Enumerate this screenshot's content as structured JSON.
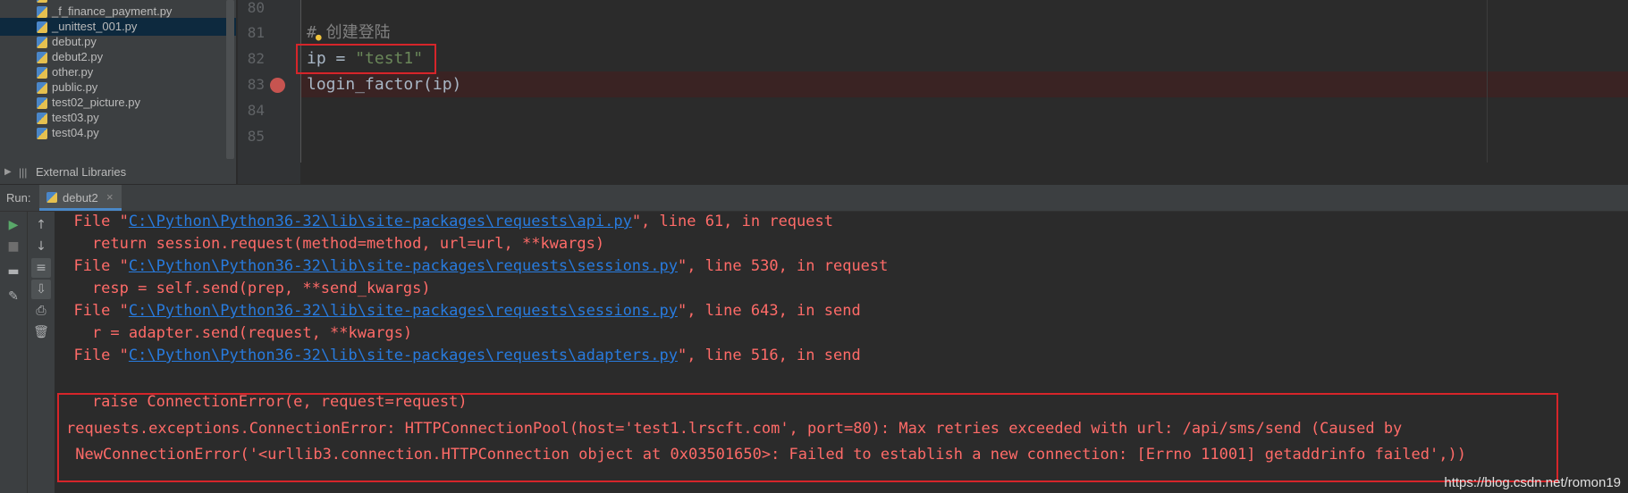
{
  "project_tree": {
    "files": [
      {
        "name": "_f_finance_payment.py",
        "selected": false
      },
      {
        "name": "_unittest_001.py",
        "selected": true
      },
      {
        "name": "debut.py",
        "selected": false
      },
      {
        "name": "debut2.py",
        "selected": false
      },
      {
        "name": "other.py",
        "selected": false
      },
      {
        "name": "public.py",
        "selected": false
      },
      {
        "name": "test02_picture.py",
        "selected": false
      },
      {
        "name": "test03.py",
        "selected": false
      },
      {
        "name": "test04.py",
        "selected": false
      }
    ],
    "external_libraries": "External Libraries"
  },
  "editor": {
    "line_numbers": [
      "80",
      "81",
      "82",
      "83",
      "84",
      "85"
    ],
    "lines": {
      "l81_comment": "# 创建登陆",
      "l82_var": "ip = ",
      "l82_str": "\"test1\"",
      "l83": "login_factor(ip)"
    },
    "breakpoint_line": "83",
    "highlight_color": "#d6252a"
  },
  "run_panel": {
    "label": "Run:",
    "tab": "debut2",
    "close_glyph": "×",
    "console": [
      {
        "pre": "  File \"",
        "link": "C:\\Python\\Python36-32\\lib\\site-packages\\requests\\api.py",
        "post": "\", line 61, in request"
      },
      {
        "text": "    return session.request(method=method, url=url, **kwargs)"
      },
      {
        "pre": "  File \"",
        "link": "C:\\Python\\Python36-32\\lib\\site-packages\\requests\\sessions.py",
        "post": "\", line 530, in request"
      },
      {
        "text": "    resp = self.send(prep, **send_kwargs)"
      },
      {
        "pre": "  File \"",
        "link": "C:\\Python\\Python36-32\\lib\\site-packages\\requests\\sessions.py",
        "post": "\", line 643, in send"
      },
      {
        "text": "    r = adapter.send(request, **kwargs)"
      },
      {
        "pre": "  File \"",
        "link": "C:\\Python\\Python36-32\\lib\\site-packages\\requests\\adapters.py",
        "post": "\", line 516, in send"
      },
      {
        "text": "    raise ConnectionError(e, request=request)"
      },
      {
        "text": "requests.exceptions.ConnectionError: HTTPConnectionPool(host='test1.lrscft.com', port=80): Max retries exceeded with url: /api/sms/send (Caused by"
      },
      {
        "text": " NewConnectionError('<urllib3.connection.HTTPConnection object at 0x03501650>: Failed to establish a new connection: [Errno 11001] getaddrinfo failed',))"
      }
    ],
    "error_color": "#ff6b68",
    "link_color": "#287bde"
  },
  "watermark": "https://blog.csdn.net/romon19"
}
